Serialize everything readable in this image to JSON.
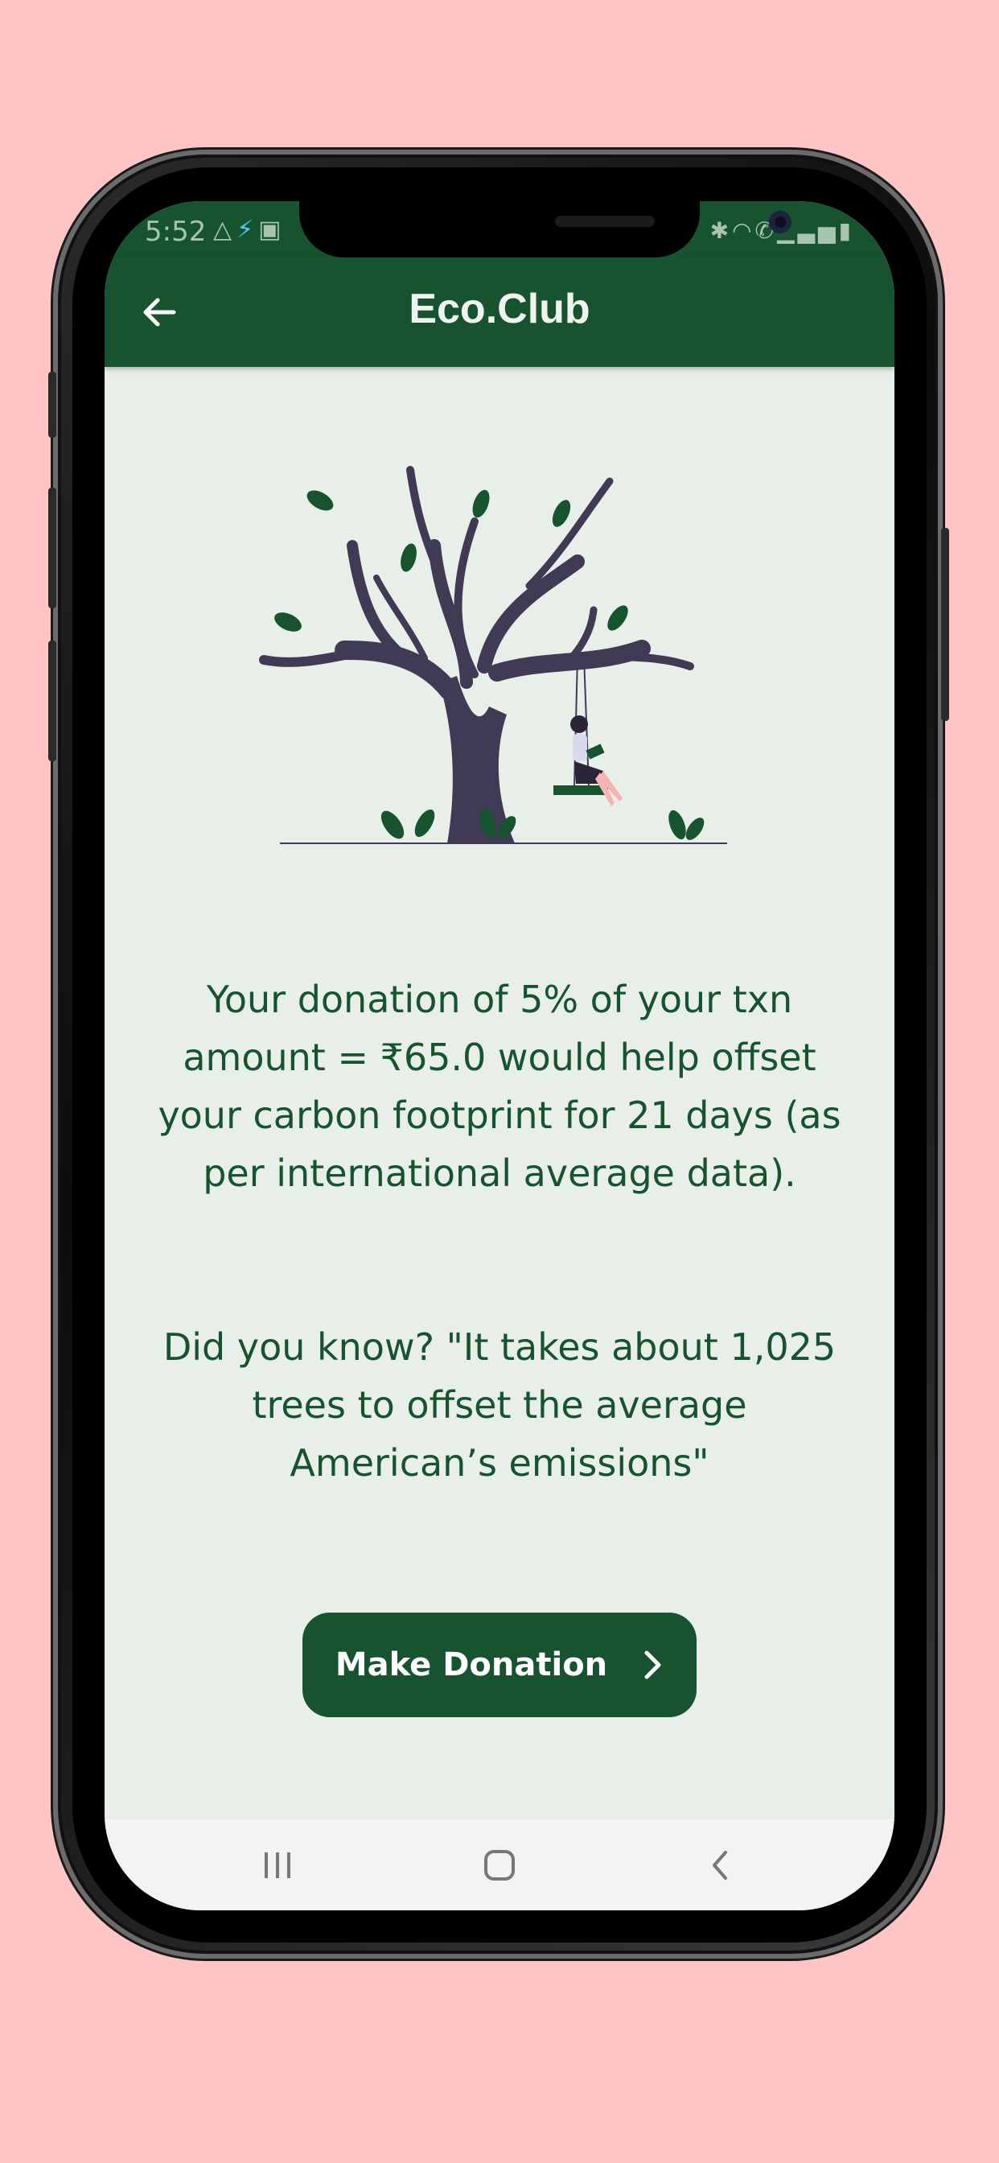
{
  "status_bar": {
    "time": "5:52",
    "left_icons": [
      "drive-icon",
      "flutter-icon",
      "image-icon"
    ],
    "right_icons": [
      "bluetooth-icon",
      "wifi-icon",
      "call-icon",
      "signal-icon",
      "battery-charging-icon"
    ]
  },
  "app_bar": {
    "title": "Eco.Club",
    "back_icon": "arrow-left-icon"
  },
  "content": {
    "donation_message": "Your donation of 5% of your txn amount = ₹65.0 would help offset your carbon footprint for 21 days (as per international average data).",
    "fact_message": "Did you know? \"It takes about 1,025 trees to offset the average American’s emissions\"",
    "illustration": "tree-with-swing-illustration"
  },
  "actions": {
    "donate_label": "Make Donation",
    "donate_icon": "chevron-right-icon"
  },
  "nav_bar": {
    "items": [
      "recents-icon",
      "home-icon",
      "back-icon"
    ]
  },
  "colors": {
    "background": "#ffc4c4",
    "primary": "#17532f",
    "screen_bg": "#e8efe9",
    "tree": "#403a55",
    "leaf": "#17532f"
  }
}
